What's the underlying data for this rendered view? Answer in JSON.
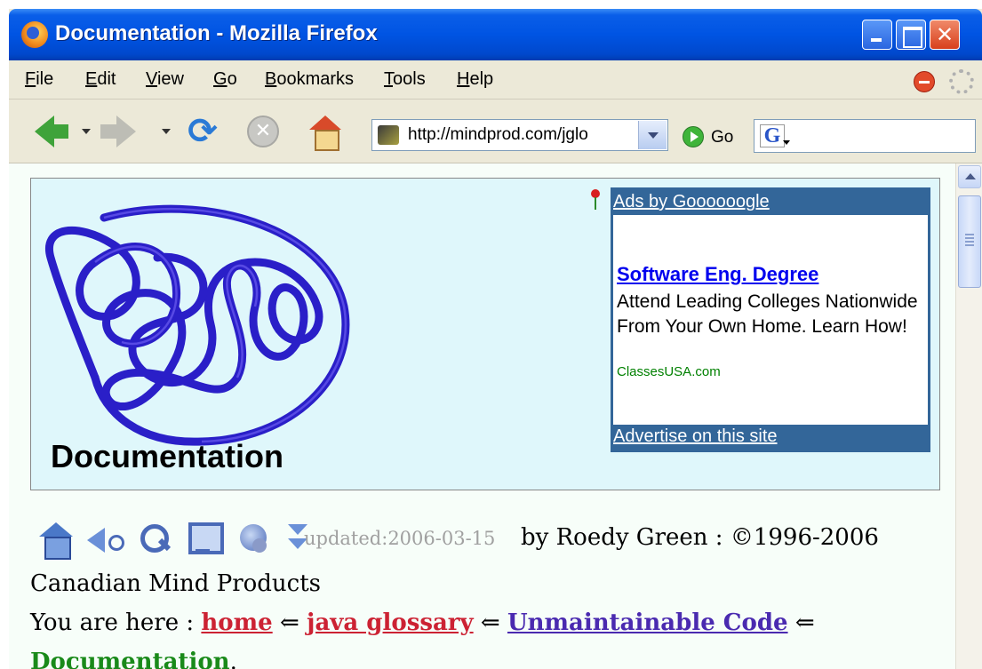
{
  "window": {
    "title": "Documentation - Mozilla Firefox"
  },
  "menu": {
    "items": [
      {
        "label": "File"
      },
      {
        "label": "Edit"
      },
      {
        "label": "View"
      },
      {
        "label": "Go"
      },
      {
        "label": "Bookmarks"
      },
      {
        "label": "Tools"
      },
      {
        "label": "Help"
      }
    ]
  },
  "toolbar": {
    "url": "http://mindprod.com/jglo",
    "go_label": "Go",
    "search_engine_glyph": "G",
    "search_value": "",
    "icons": [
      "back-arrow-icon",
      "forward-arrow-icon",
      "reload-icon",
      "stop-icon",
      "home-icon",
      "go-icon"
    ]
  },
  "banner": {
    "title": "Documentation",
    "ad": {
      "header_link": "Ads by Goooooogle",
      "title": "Software Eng. Degree",
      "body": "Attend Leading Colleges Nationwide From Your Own Home. Learn How!",
      "url": "ClassesUSA.com",
      "footer_link": "Advertise on this site"
    }
  },
  "page": {
    "updated": "updated:2006-03-15",
    "byline": "by Roedy Green : ©1996-2006",
    "company": "Canadian Mind Products",
    "breadcrumb": {
      "prefix": "You are here :",
      "separator": "⇐",
      "links": [
        "home",
        "java glossary",
        "Unmaintainable Code"
      ],
      "current": "Documentation",
      "end": "."
    }
  },
  "colors": {
    "titlebar": "#0054e3",
    "content_bg": "#f7fef9",
    "banner_bg": "#dff7fb",
    "ad_frame": "#336699",
    "crumb_red": "#cc2233",
    "crumb_blue": "#4a2ab0",
    "crumb_current": "#1a8a1a"
  }
}
